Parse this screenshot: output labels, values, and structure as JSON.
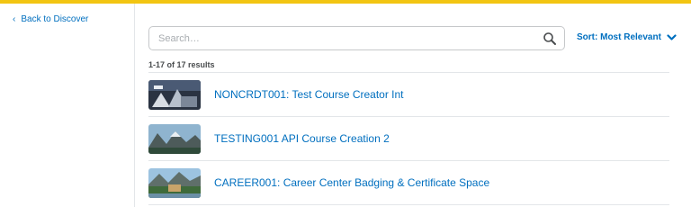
{
  "nav": {
    "back_label": "Back to Discover"
  },
  "search": {
    "placeholder": "Search…",
    "value": ""
  },
  "sort": {
    "label": "Sort: Most Relevant"
  },
  "results": {
    "count_label": "1-17 of 17 results"
  },
  "courses": [
    {
      "title": "NONCRDT001: Test Course Creator Int"
    },
    {
      "title": "TESTING001 API Course Creation 2"
    },
    {
      "title": "CAREER001: Career Center Badging & Certificate Space"
    }
  ],
  "colors": {
    "accent_bar": "#f2c512",
    "link": "#006fbf",
    "border": "#e3e6e9"
  }
}
